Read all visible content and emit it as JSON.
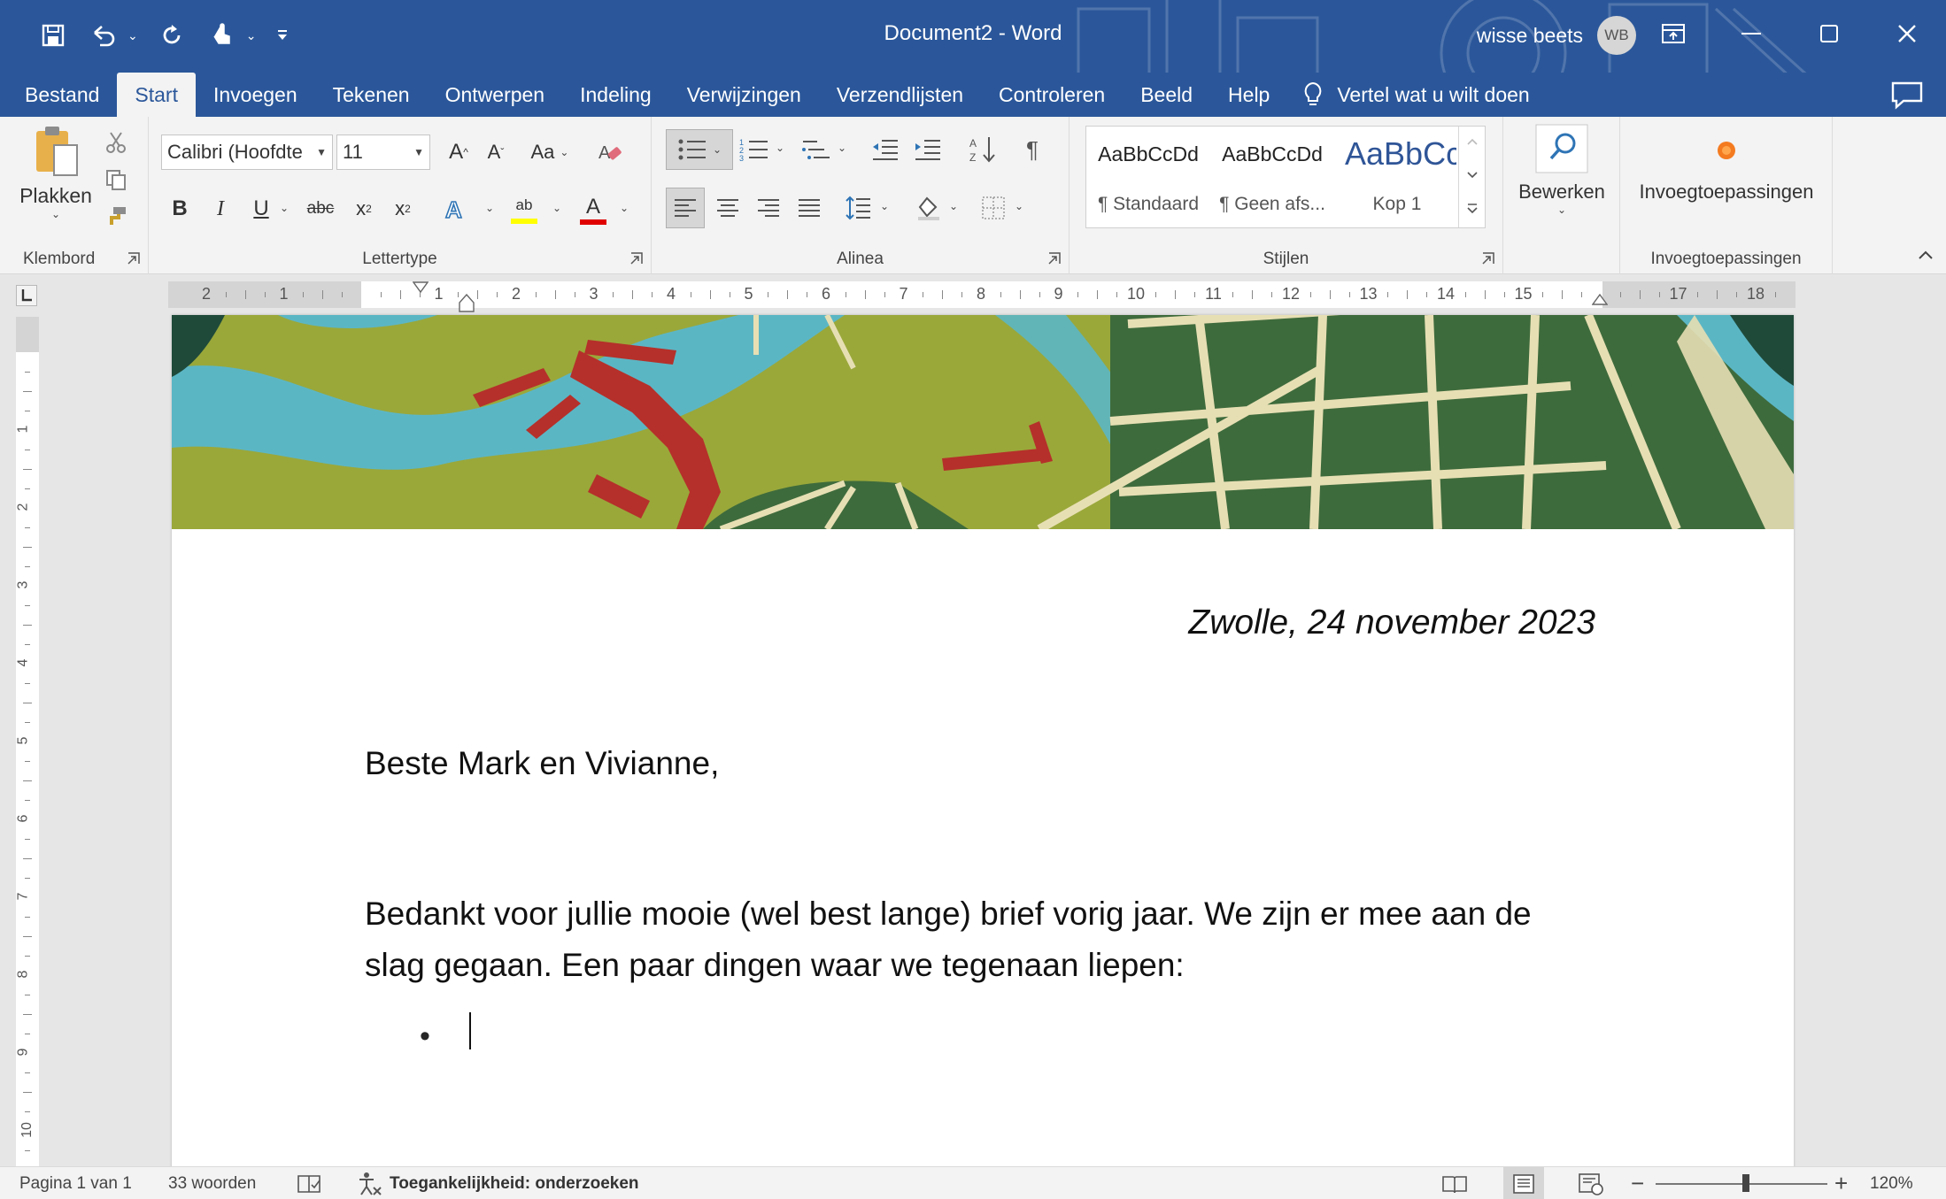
{
  "window": {
    "title": "Document2  -  Word",
    "user_name": "wisse beets",
    "user_initials": "WB"
  },
  "tabs": [
    "Bestand",
    "Start",
    "Invoegen",
    "Tekenen",
    "Ontwerpen",
    "Indeling",
    "Verwijzingen",
    "Verzendlijsten",
    "Controleren",
    "Beeld",
    "Help"
  ],
  "active_tab": "Start",
  "tell_me": "Vertel wat u wilt doen",
  "ribbon": {
    "clipboard": {
      "label": "Klembord",
      "paste": "Plakken"
    },
    "font": {
      "label": "Lettertype",
      "font_name": "Calibri (Hoofdte",
      "font_size": "11",
      "change_case": "Aa"
    },
    "paragraph": {
      "label": "Alinea"
    },
    "styles": {
      "label": "Stijlen",
      "items": [
        {
          "preview": "AaBbCcDd",
          "name": "¶ Standaard"
        },
        {
          "preview": "AaBbCcDd",
          "name": "¶ Geen afs..."
        },
        {
          "preview": "AaBbCc",
          "name": "Kop 1"
        }
      ]
    },
    "editing": {
      "label": "Bewerken"
    },
    "addins": {
      "button": "Invoegtoepassingen",
      "label": "Invoegtoepassingen"
    }
  },
  "ruler": {
    "h_numbers": [
      "2",
      "1",
      "1",
      "2",
      "3",
      "4",
      "5",
      "6",
      "7",
      "8",
      "9",
      "10",
      "11",
      "12",
      "13",
      "14",
      "15",
      "17",
      "18"
    ],
    "v_numbers": [
      "1",
      "2",
      "3",
      "4",
      "5",
      "6",
      "7",
      "8",
      "9",
      "10"
    ]
  },
  "document": {
    "date_line": "Zwolle, 24 november 2023",
    "salutation": "Beste Mark en Vivianne,",
    "paragraph": "Bedankt voor jullie mooie (wel best lange) brief vorig jaar. We zijn er mee aan de slag gegaan. Een paar dingen waar we tegenaan liepen:",
    "bullet": "•"
  },
  "status": {
    "page": "Pagina 1 van 1",
    "words": "33 woorden",
    "accessibility": "Toegankelijkheid: onderzoeken",
    "zoom": "120%",
    "zoom_level_percent": 120,
    "zoom_minus": "−",
    "zoom_plus": "+"
  },
  "colors": {
    "titlebar": "#2b579a",
    "ribbon": "#f3f3f3",
    "banner_olive": "#9aa83a",
    "banner_teal": "#5bb6c4",
    "banner_green": "#3e6b3c",
    "banner_red": "#b5302a"
  }
}
